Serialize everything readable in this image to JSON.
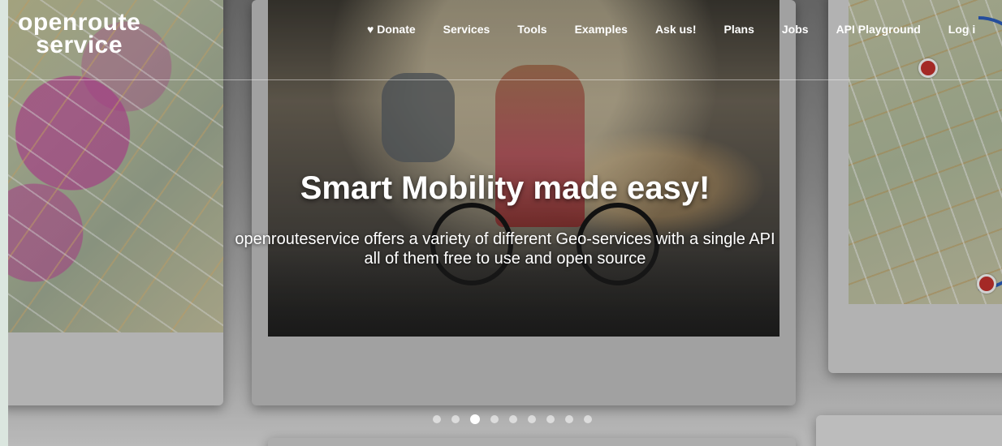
{
  "header": {
    "logo": {
      "line1": "openroute",
      "line2": "service"
    },
    "nav": [
      {
        "label": "♥ Donate"
      },
      {
        "label": "Services"
      },
      {
        "label": "Tools"
      },
      {
        "label": "Examples"
      },
      {
        "label": "Ask us!"
      },
      {
        "label": "Plans"
      },
      {
        "label": "Jobs"
      },
      {
        "label": "API Playground"
      },
      {
        "label": "Log i"
      }
    ]
  },
  "hero": {
    "title": "Smart Mobility made easy!",
    "subtitle_line1": "openrouteservice offers a variety of different Geo-services with a single API",
    "subtitle_line2": "all of them free to use and open source"
  },
  "carousel": {
    "total_slides": 9,
    "active_index": 2
  }
}
